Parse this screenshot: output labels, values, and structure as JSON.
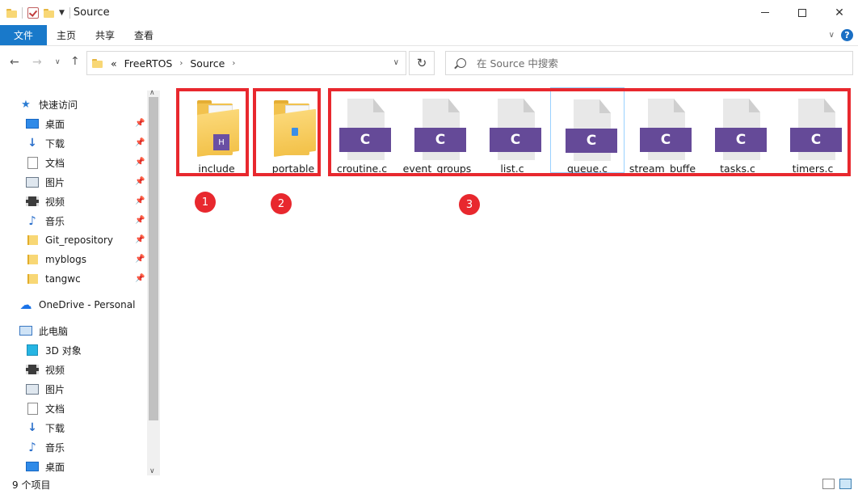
{
  "window": {
    "title": "Source"
  },
  "ribbon": {
    "tabs": [
      "文件",
      "主页",
      "共享",
      "查看"
    ]
  },
  "address": {
    "crumbs": [
      "«",
      "FreeRTOS",
      "Source"
    ]
  },
  "search": {
    "placeholder": "在 Source 中搜索"
  },
  "sidebar": {
    "quick_access": "快速访问",
    "quick_items": [
      "桌面",
      "下载",
      "文档",
      "图片",
      "视频",
      "音乐",
      "Git_repository",
      "myblogs",
      "tangwc"
    ],
    "onedrive": "OneDrive - Personal",
    "this_pc": "此电脑",
    "pc_items": [
      "3D 对象",
      "视频",
      "图片",
      "文档",
      "下载",
      "音乐",
      "桌面"
    ]
  },
  "files": [
    {
      "name": "include",
      "kind": "folder",
      "badge": "H"
    },
    {
      "name": "portable",
      "kind": "folder",
      "badge": ""
    },
    {
      "name": "croutine.c",
      "kind": "c",
      "badge": "C"
    },
    {
      "name": "event_groups",
      "kind": "c",
      "badge": "C"
    },
    {
      "name": "list.c",
      "kind": "c",
      "badge": "C"
    },
    {
      "name": "queue.c",
      "kind": "c",
      "badge": "C"
    },
    {
      "name": "stream_buffe",
      "kind": "c",
      "badge": "C"
    },
    {
      "name": "tasks.c",
      "kind": "c",
      "badge": "C"
    },
    {
      "name": "timers.c",
      "kind": "c",
      "badge": "C"
    }
  ],
  "markers": [
    "1",
    "2",
    "3"
  ],
  "status": {
    "item_count": "9 个项目"
  },
  "colors": {
    "accent": "#1979ca",
    "highlight": "#e8282e",
    "c_badge": "#654a98"
  }
}
